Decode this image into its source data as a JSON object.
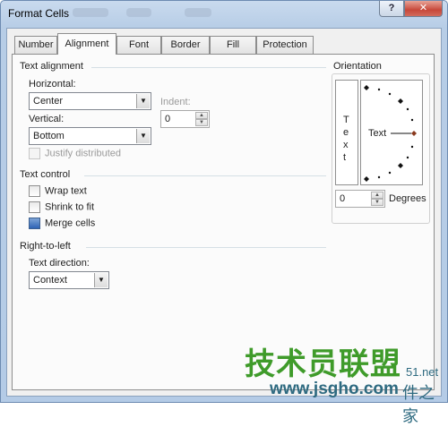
{
  "window": {
    "title": "Format Cells",
    "help_glyph": "?",
    "close_glyph": "✕"
  },
  "tabs": [
    {
      "label": "Number"
    },
    {
      "label": "Alignment"
    },
    {
      "label": "Font"
    },
    {
      "label": "Border"
    },
    {
      "label": "Fill"
    },
    {
      "label": "Protection"
    }
  ],
  "text_alignment": {
    "section_label": "Text alignment",
    "horizontal_label": "Horizontal:",
    "horizontal_value": "Center",
    "indent_label": "Indent:",
    "indent_value": "0",
    "vertical_label": "Vertical:",
    "vertical_value": "Bottom",
    "justify_distributed_label": "Justify distributed"
  },
  "text_control": {
    "section_label": "Text control",
    "wrap_text_label": "Wrap text",
    "shrink_to_fit_label": "Shrink to fit",
    "merge_cells_label": "Merge cells",
    "wrap_text_checked": false,
    "shrink_to_fit_checked": false,
    "merge_cells_checked": true
  },
  "right_to_left": {
    "section_label": "Right-to-left",
    "text_direction_label": "Text direction:",
    "text_direction_value": "Context"
  },
  "orientation": {
    "section_label": "Orientation",
    "vertical_text_letters": [
      "T",
      "e",
      "x",
      "t"
    ],
    "dial_text": "Text",
    "degrees_value": "0",
    "degrees_label": "Degrees"
  },
  "watermark": {
    "brand_cn": "技术员联盟",
    "site_url": "www.jsgho.com",
    "partial_domain": "51.net",
    "partial_cn": "件之家"
  },
  "colors": {
    "watermark_green": "#3f9b2a",
    "watermark_teal": "#2e6a80",
    "dial_marker": "#8a3a1e"
  }
}
